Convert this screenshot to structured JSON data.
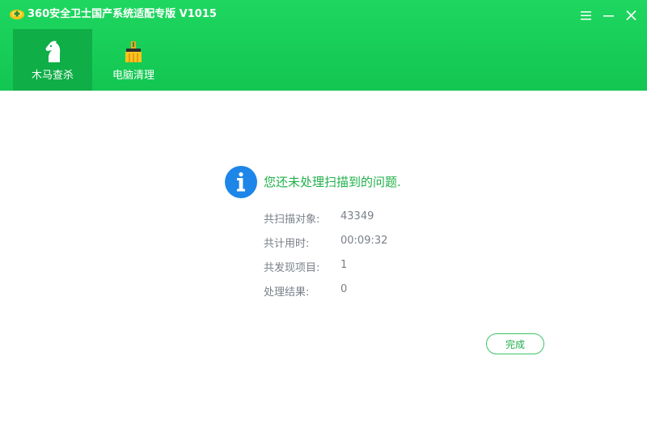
{
  "window": {
    "title": "360安全卫士国产系统适配专版  V1015",
    "accent_color": "#1ed760",
    "controls": {
      "menu_icon": "hamburger-menu-icon",
      "minimize_icon": "minimize-icon",
      "close_icon": "close-icon"
    }
  },
  "tabs": [
    {
      "label": "木马查杀",
      "icon": "horse-icon",
      "active": true
    },
    {
      "label": "电脑清理",
      "icon": "broom-brush-icon",
      "active": false
    }
  ],
  "result": {
    "icon": "info-icon",
    "message": "您还未处理扫描到的问题.",
    "stats": [
      {
        "label": "共扫描对象:",
        "value": "43349"
      },
      {
        "label": "共计用时:",
        "value": "00:09:32"
      },
      {
        "label": "共发现项目:",
        "value": "1"
      },
      {
        "label": "处理结果:",
        "value": "0"
      }
    ],
    "finish_button": "完成"
  }
}
